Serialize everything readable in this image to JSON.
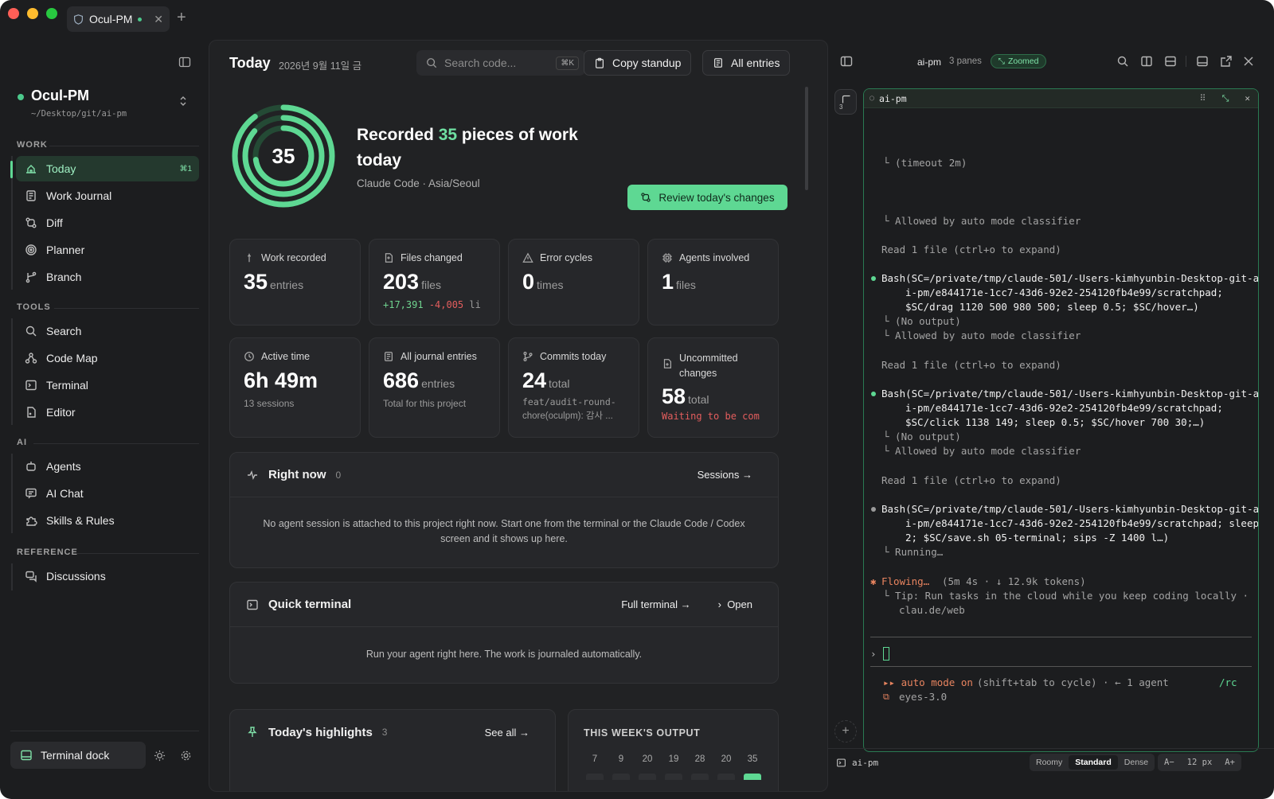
{
  "colors": {
    "accent": "#5ed893",
    "accent_text": "#7fe0a8",
    "error": "#e35d5d",
    "added": "#6fd38f",
    "bg": "#1c1d1f"
  },
  "window": {
    "tab_title": "Ocul-PM",
    "new_tab": "+"
  },
  "project": {
    "name": "Ocul-PM",
    "path": "~/Desktop/git/ai-pm"
  },
  "sidebar": {
    "sections": {
      "work": "WORK",
      "tools": "TOOLS",
      "ai": "AI",
      "reference": "REFERENCE"
    },
    "work": [
      {
        "label": "Today",
        "shortcut": "⌘1",
        "icon": "home-icon"
      },
      {
        "label": "Work Journal",
        "icon": "journal-icon"
      },
      {
        "label": "Diff",
        "icon": "diff-icon"
      },
      {
        "label": "Planner",
        "icon": "target-icon"
      },
      {
        "label": "Branch",
        "icon": "branch-icon"
      }
    ],
    "tools": [
      {
        "label": "Search",
        "icon": "search-icon"
      },
      {
        "label": "Code Map",
        "icon": "map-icon"
      },
      {
        "label": "Terminal",
        "icon": "terminal-icon"
      },
      {
        "label": "Editor",
        "icon": "file-icon"
      }
    ],
    "ai": [
      {
        "label": "Agents",
        "icon": "robot-icon"
      },
      {
        "label": "AI Chat",
        "icon": "chat-icon"
      },
      {
        "label": "Skills & Rules",
        "icon": "puzzle-icon"
      }
    ],
    "reference": [
      {
        "label": "Discussions",
        "icon": "discussion-icon"
      }
    ],
    "dock_label": "Terminal dock"
  },
  "header": {
    "title": "Today",
    "date": "2026년 9월 11일 금",
    "search_placeholder": "Search code...",
    "search_kbd": "⌘K",
    "copy_standup": "Copy standup",
    "all_entries": "All entries"
  },
  "hero": {
    "count": "35",
    "line_pre": "Recorded ",
    "line_post": " pieces of work today",
    "subtitle": "Claude Code · Asia/Seoul",
    "review_button": "Review today's changes"
  },
  "stats": [
    {
      "label": "Work recorded",
      "value": "35",
      "unit": "entries"
    },
    {
      "label": "Files changed",
      "value": "203",
      "unit": "files",
      "added": "+17,391",
      "removed": "-4,005",
      "tail": "li"
    },
    {
      "label": "Error cycles",
      "value": "0",
      "unit": "times"
    },
    {
      "label": "Agents involved",
      "value": "1",
      "unit": "files"
    },
    {
      "label": "Active time",
      "value": "6h 49m",
      "sub": "13 sessions"
    },
    {
      "label": "All journal entries",
      "value": "686",
      "unit": "entries",
      "sub": "Total for this project"
    },
    {
      "label": "Commits today",
      "value": "24",
      "unit": "total",
      "sub1": "feat/audit-round-",
      "sub2": "chore(oculpm): 감사 ..."
    },
    {
      "label": "Uncommitted changes",
      "value": "58",
      "unit": "total",
      "sub": "Waiting to be com"
    }
  ],
  "right_now": {
    "title": "Right now",
    "count": "0",
    "sessions_link": "Sessions",
    "body": "No agent session is attached to this project right now. Start one from the terminal or the Claude Code / Codex screen and it shows up here."
  },
  "quick_terminal": {
    "title": "Quick terminal",
    "full_link": "Full terminal",
    "open_link": "Open",
    "body": "Run your agent right here. The work is journaled automatically."
  },
  "highlights": {
    "title": "Today's highlights",
    "count": "3",
    "see_all": "See all"
  },
  "week": {
    "title": "THIS WEEK'S OUTPUT",
    "values": [
      "7",
      "9",
      "20",
      "19",
      "28",
      "20",
      "35"
    ]
  },
  "terminal": {
    "name": "ai-pm",
    "panes": "3 panes",
    "zoomed": "Zoomed",
    "pane_title": "ai-pm",
    "side_badge": "3",
    "lines": [
      "└ (timeout 2m)",
      "└ Allowed by auto mode classifier",
      "Read 1 file (ctrl+o to expand)",
      "Bash(SC=/private/tmp/claude-501/-Users-kimhyunbin-Desktop-git-a",
      "i-pm/e844171e-1cc7-43d6-92e2-254120fb4e99/scratchpad;",
      "$SC/drag 1120 500 980 500; sleep 0.5; $SC/hover…)",
      "└ (No output)",
      "└ Allowed by auto mode classifier",
      "Read 1 file (ctrl+o to expand)",
      "Bash(SC=/private/tmp/claude-501/-Users-kimhyunbin-Desktop-git-a",
      "i-pm/e844171e-1cc7-43d6-92e2-254120fb4e99/scratchpad;",
      "$SC/click 1138 149; sleep 0.5; $SC/hover 700 30;…)",
      "└ (No output)",
      "└ Allowed by auto mode classifier",
      "Read 1 file (ctrl+o to expand)",
      "Bash(SC=/private/tmp/claude-501/-Users-kimhyunbin-Desktop-git-a",
      "i-pm/e844171e-1cc7-43d6-92e2-254120fb4e99/scratchpad; sleep",
      "2; $SC/save.sh 05-terminal; sips -Z 1400 l…)",
      "└ Running…",
      "Flowing…",
      "(5m 4s · ↓ 12.9k tokens)",
      "└ Tip: Run tasks in the cloud while you keep coding locally ·",
      "clau.de/web",
      "▸▸ auto mode on",
      "(shift+tab to cycle) · ← 1 agent",
      "/rc",
      "eyes-3.0"
    ],
    "footer_name": "ai-pm",
    "density": [
      "Roomy",
      "Standard",
      "Dense"
    ],
    "font_dec": "A−",
    "font_size": "12 px",
    "font_inc": "A+"
  }
}
